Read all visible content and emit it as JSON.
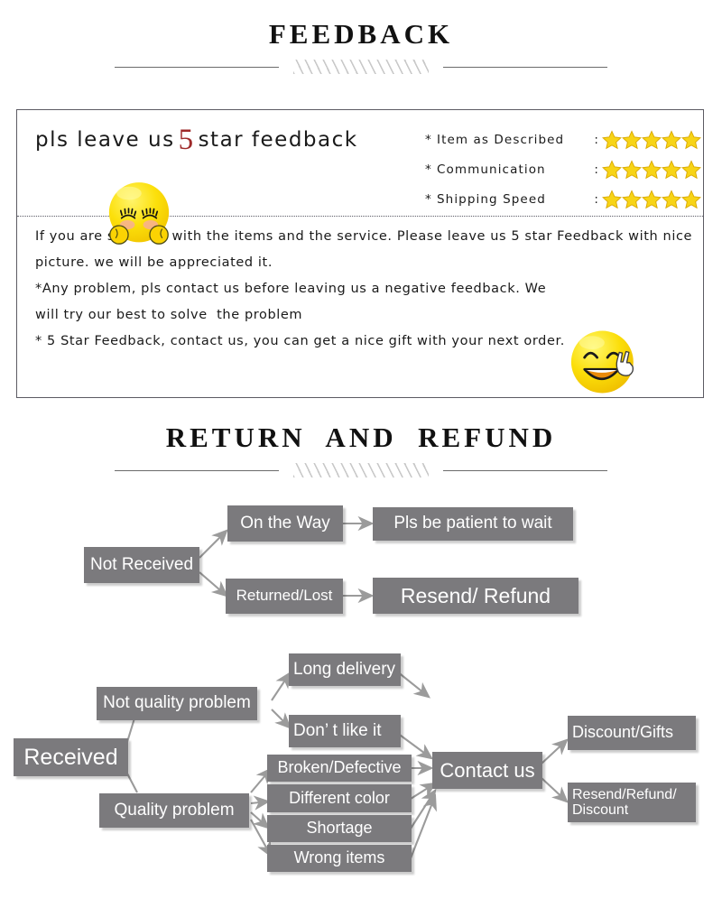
{
  "sections": {
    "feedback_heading": "FEEDBACK",
    "return_heading": "RETURN  AND  REFUND"
  },
  "feedback": {
    "headline_before": "pls leave us",
    "headline_number": "5",
    "headline_after": "star feedback",
    "ratings": [
      {
        "bullet": "*",
        "label": "Item as Described",
        "colon": ":",
        "stars": 5
      },
      {
        "bullet": "*",
        "label": "Communication",
        "colon": ":",
        "stars": 5
      },
      {
        "bullet": "*",
        "label": "Shipping Speed",
        "colon": ":",
        "stars": 5
      }
    ],
    "star_color": "#F7D417",
    "star_outline": "#D9A800",
    "body_lines": [
      "If you are satisfied with the items and the service. Please leave us 5 star Feedback with nice",
      "picture. we will be appreciated it.",
      "*Any problem, pls contact us before leaving us a negative feedback. We",
      "will try our best to solve  the problem",
      "* 5 Star Feedback, contact us, you can get a nice gift with your next order."
    ],
    "emoji_shy": "shy-closed-eyes-face",
    "emoji_peace": "smiling-face-peace-hand"
  },
  "flowchart": {
    "node_color": "#7b7a7d",
    "text_color": "#ffffff",
    "arrow_color": "#9a9a9a",
    "nodes": [
      {
        "id": "not-received",
        "label": "Not Received"
      },
      {
        "id": "on-the-way",
        "label": "On the Way"
      },
      {
        "id": "pls-be-patient",
        "label": "Pls be patient to wait"
      },
      {
        "id": "returned-lost",
        "label": "Returned/Lost"
      },
      {
        "id": "resend-refund",
        "label": "Resend/ Refund"
      },
      {
        "id": "received",
        "label": "Received"
      },
      {
        "id": "not-quality",
        "label": "Not quality problem"
      },
      {
        "id": "long-delivery",
        "label": "Long delivery"
      },
      {
        "id": "dont-like-it",
        "label": "Don’ t like it"
      },
      {
        "id": "quality-problem",
        "label": "Quality problem"
      },
      {
        "id": "broken-defective",
        "label": "Broken/Defective"
      },
      {
        "id": "different-color",
        "label": "Different color"
      },
      {
        "id": "shortage",
        "label": "Shortage"
      },
      {
        "id": "wrong-items",
        "label": "Wrong items"
      },
      {
        "id": "contact-us",
        "label": "Contact us"
      },
      {
        "id": "discount-gifts",
        "label": "Discount/Gifts"
      },
      {
        "id": "resend-refund-disc",
        "label": "Resend/Refund/\nDiscount"
      }
    ]
  }
}
